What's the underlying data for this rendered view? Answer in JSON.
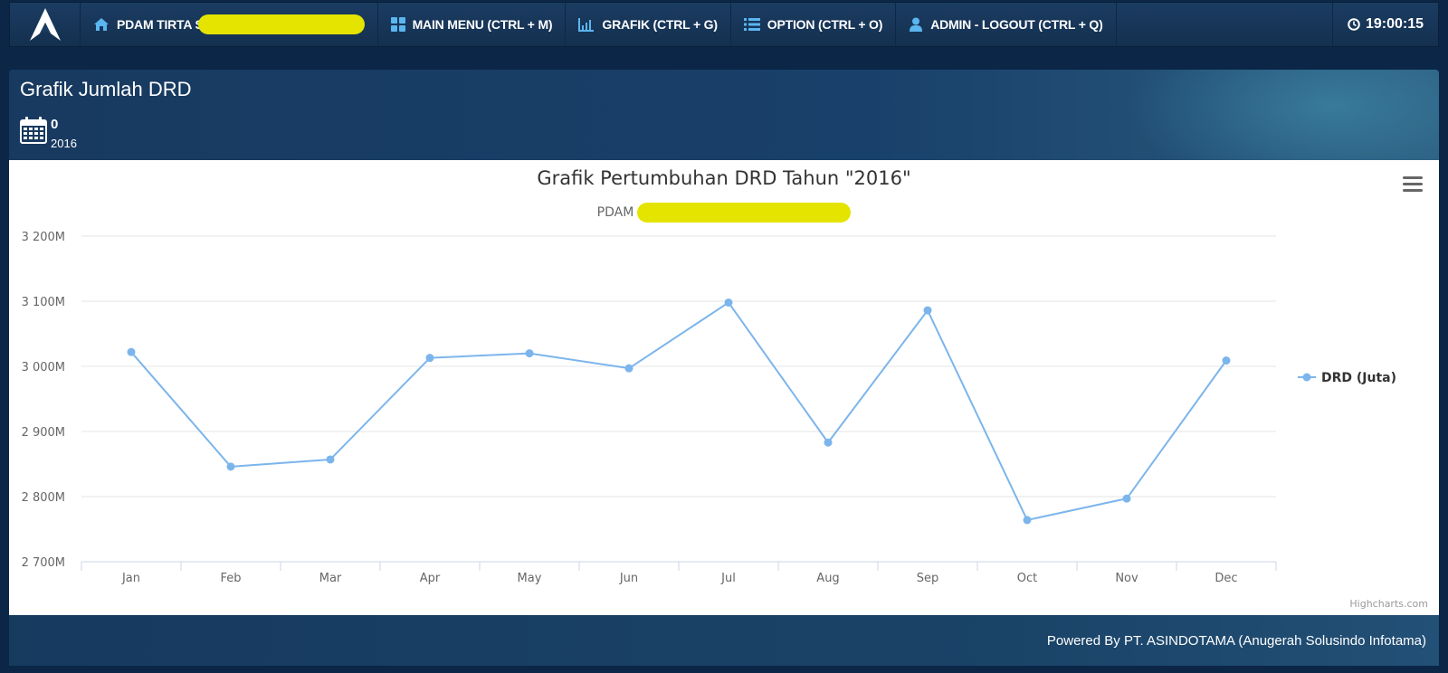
{
  "navbar": {
    "items": [
      {
        "label": "PDAM TIRTA S",
        "icon": "home-icon"
      },
      {
        "label": "MAIN MENU (CTRL + M)",
        "icon": "grid-icon"
      },
      {
        "label": "GRAFIK (CTRL + G)",
        "icon": "bar-chart-icon"
      },
      {
        "label": "OPTION (CTRL + O)",
        "icon": "list-icon"
      },
      {
        "label": "ADMIN - LOGOUT (CTRL + Q)",
        "icon": "user-icon"
      }
    ],
    "clock": "19:00:15",
    "redaction_color": "#e4e400"
  },
  "header": {
    "title": "Grafik Jumlah DRD",
    "count": "0",
    "year": "2016"
  },
  "chart_data": {
    "type": "line",
    "title": "Grafik Pertumbuhan DRD Tahun \"2016\"",
    "subtitle": "PDAM",
    "categories": [
      "Jan",
      "Feb",
      "Mar",
      "Apr",
      "May",
      "Jun",
      "Jul",
      "Aug",
      "Sep",
      "Oct",
      "Nov",
      "Dec"
    ],
    "series": [
      {
        "name": "DRD (Juta)",
        "color": "#7cb5ec",
        "values": [
          3022,
          2846,
          2857,
          3013,
          3020,
          2997,
          3098,
          2883,
          3086,
          2764,
          2797,
          3009
        ]
      }
    ],
    "ylim": [
      2700,
      3200
    ],
    "yticks": [
      2700,
      2800,
      2900,
      3000,
      3100,
      3200
    ],
    "ytick_labels": [
      "2 700M",
      "2 800M",
      "2 900M",
      "3 000M",
      "3 100M",
      "3 200M"
    ],
    "grid": true,
    "legend": "right",
    "credits": "Highcharts.com"
  },
  "footer": {
    "text": "Powered By PT. ASINDOTAMA (Anugerah Solusindo Infotama)"
  }
}
